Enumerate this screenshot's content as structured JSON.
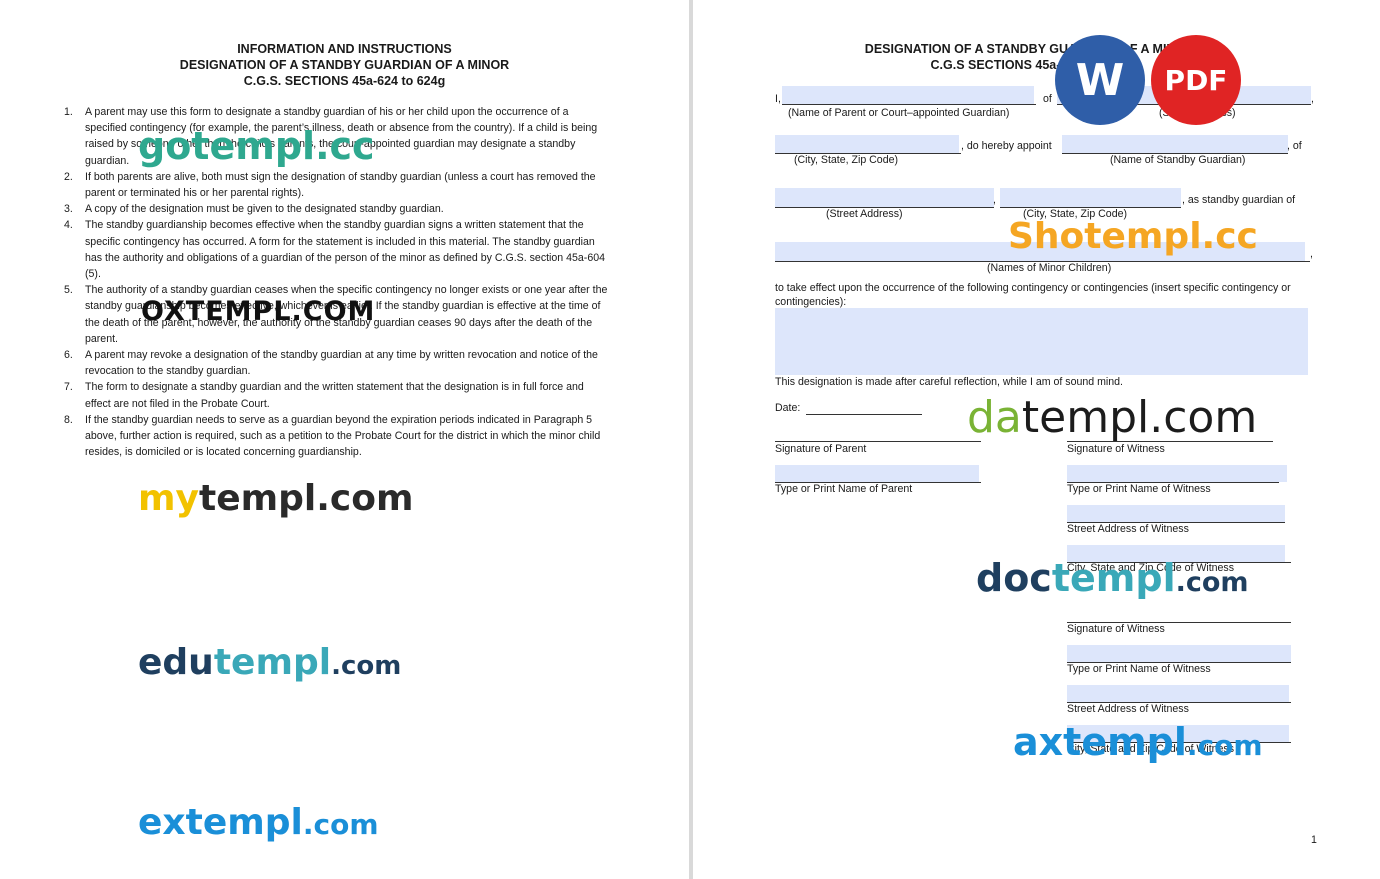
{
  "left_page": {
    "title_lines": [
      "INFORMATION AND INSTRUCTIONS",
      "DESIGNATION OF A STANDBY GUARDIAN OF A MINOR",
      "C.G.S. SECTIONS 45a-624 to 624g"
    ],
    "instructions": [
      {
        "num": "1.",
        "text": "A parent may use this form to designate a standby guardian of his or her child upon the occurrence of a specified contingency (for example, the parent’s illness, death or absence from the country). If a child is being raised by someone other than the child’s parents, the court-appointed guardian may designate a standby guardian."
      },
      {
        "num": "2.",
        "text": "If both parents are alive, both must sign the designation of standby guardian (unless a court has removed the parent or terminated his or her parental rights)."
      },
      {
        "num": "3.",
        "text": "A copy of the designation must be given to the designated standby guardian."
      },
      {
        "num": "4.",
        "text": "The standby guardianship becomes effective when the standby guardian signs a written statement that the specific contingency has occurred. A form for the statement is included in this material. The standby guardian has the authority and obligations of a guardian of the person of the minor as defined by C.G.S. section 45a-604 (5)."
      },
      {
        "num": "5.",
        "text": "The authority of a standby guardian ceases when the specific contingency no longer exists or one year after the standby guardianship becomes effective, whichever is earlier. If the standby guardian is effective at the time of the death of the parent, however, the authority of the standby guardian ceases 90 days after the death of the parent."
      },
      {
        "num": "6.",
        "text": "A parent may revoke a designation of the standby guardian at any time by written revocation and notice of the revocation to the standby guardian."
      },
      {
        "num": "7.",
        "text": "The form to designate a standby guardian and the written statement that the designation is in full force and effect are not filed in the Probate Court."
      },
      {
        "num": "8.",
        "text": "If the standby guardian needs to serve as a guardian beyond the expiration periods indicated in Paragraph 5 above, further action is required, such as a petition to the Probate Court for the district in which the minor child resides, is domiciled or is located concerning guardianship."
      }
    ]
  },
  "right_page": {
    "title_lines": [
      "DESIGNATION OF A STANDBY GUARDIAN OF A MINOR",
      "C.G.S SECTIONS 45a-624 to 624g"
    ],
    "i_prefix": "I,",
    "of_word": "of",
    "comma": ",",
    "label_parent_name": "(Name of Parent or Court–appointed Guardian)",
    "label_street_top": "(Street Address)",
    "label_city_1": "(City, State, Zip Code)",
    "do_hereby_appoint": ", do hereby appoint",
    "of_end": ", of",
    "label_standby_name": "(Name of Standby Guardian)",
    "label_street": "(Street Address)",
    "label_city_2": "(City, State, Zip Code)",
    "as_standby": ", as standby guardian of",
    "label_minors": "(Names of Minor Children)",
    "contingency_text": "to take effect upon the occurrence of the following contingency or contingencies (insert specific contingency or contingencies):",
    "sound_mind": "This designation is made after careful reflection, while I am of sound mind.",
    "date_label": "Date:",
    "sig_parent": "Signature of Parent",
    "name_parent": "Type or Print Name of Parent",
    "witness_labels": [
      "Signature of Witness",
      "Type or Print Name of Witness",
      "Street Address of Witness",
      "City, State and Zip Code of Witness",
      "Signature of Witness",
      "Type or Print Name of Witness",
      "Street Address of Witness",
      "City, State and Zip Code of Witness"
    ],
    "page_number": "1"
  },
  "badges": {
    "word": "W",
    "pdf": "PDF",
    "word_color": "#2f5ea8",
    "pdf_color": "#e02424"
  },
  "watermarks": {
    "gotempl": "gotempl.cc",
    "oxtempl": "OXTEMPL.COM",
    "mytempl_a": "my",
    "mytempl_b": "templ.com",
    "edutempl_a": "edu",
    "edutempl_b": "templ",
    "edutempl_c": ".com",
    "extempl_a": "extempl",
    "extempl_b": ".com",
    "shotempl": "Shotempl.cc",
    "datempl_a": "da",
    "datempl_b": "templ.com",
    "doctempl_a": "doc",
    "doctempl_b": "templ",
    "doctempl_c": ".com",
    "axtempl_a": "axtempl",
    "axtempl_b": ".com"
  }
}
